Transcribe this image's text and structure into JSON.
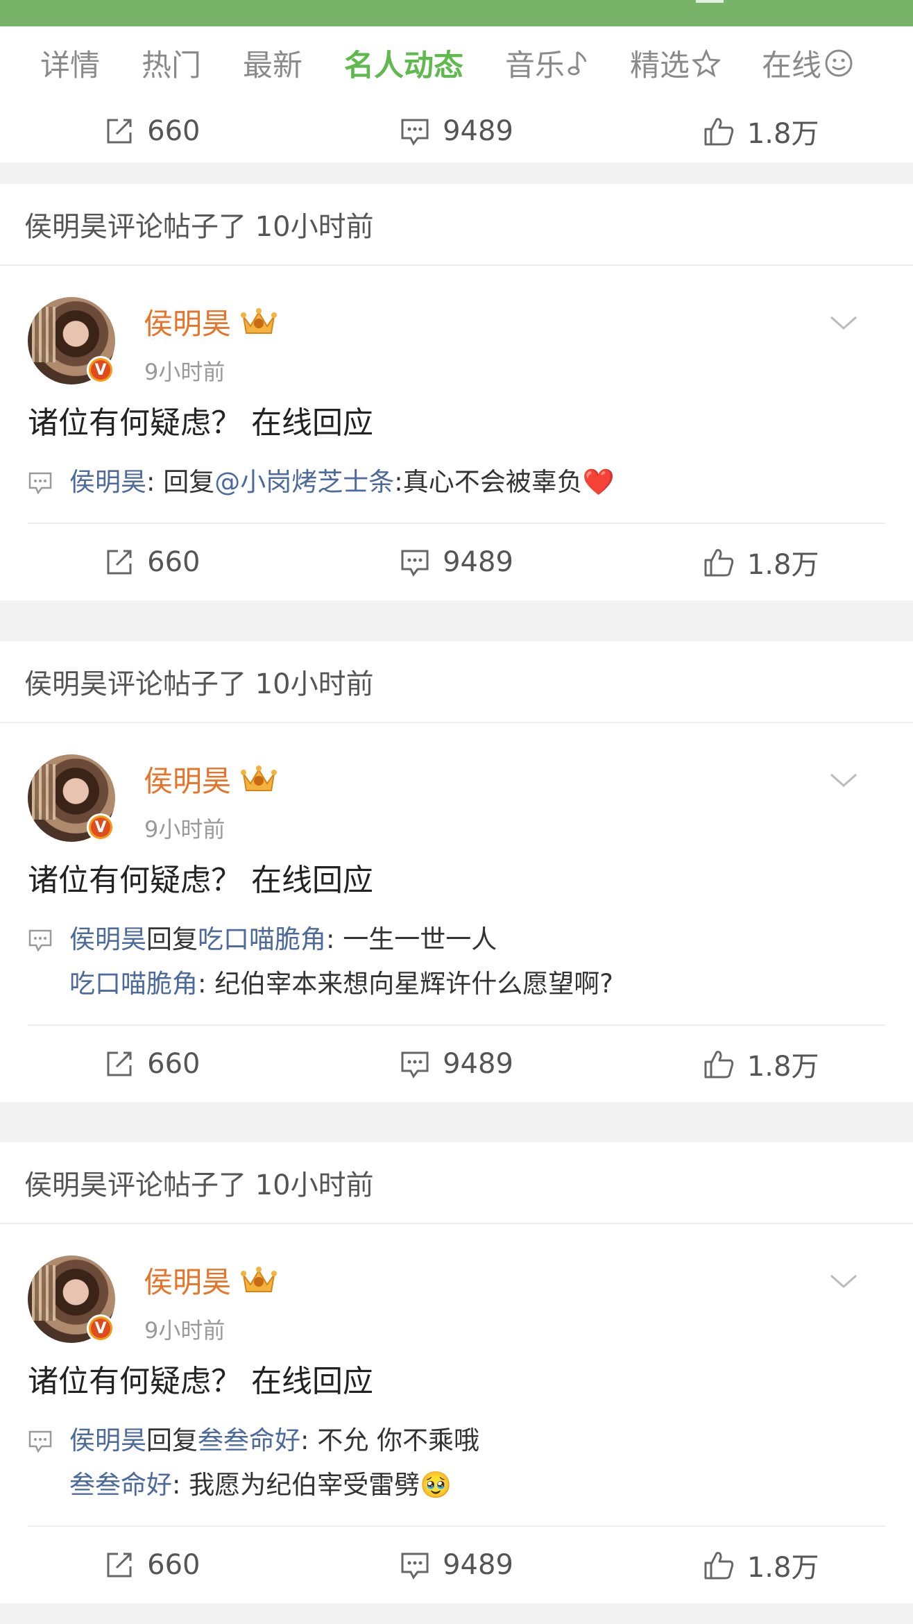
{
  "tabs": [
    {
      "label": "详情",
      "active": false
    },
    {
      "label": "热门",
      "active": false
    },
    {
      "label": "最新",
      "active": false
    },
    {
      "label": "名人动态",
      "active": true
    },
    {
      "label": "音乐",
      "active": false,
      "icon": "music-note-icon"
    },
    {
      "label": "精选",
      "active": false,
      "icon": "star-icon"
    },
    {
      "label": "在线",
      "active": false,
      "icon": "smiley-icon"
    }
  ],
  "stats": {
    "repost": "660",
    "comments": "9489",
    "likes": "1.8万"
  },
  "accent_color": "#5fba4e",
  "username_color": "#e8742a",
  "link_color": "#4c6a9c",
  "sections": [
    {
      "header": "侯明昊评论帖子了 10小时前",
      "user": {
        "name": "侯明昊",
        "time": "9小时前"
      },
      "content": "诸位有何疑虑？  在线回应",
      "reply_line1": {
        "author": "侯明昊",
        "middle": ": 回复",
        "target": "@小岗烤芝士条",
        "text": ":真心不会被辜负",
        "emoji": "❤️"
      }
    },
    {
      "header": "侯明昊评论帖子了 10小时前",
      "user": {
        "name": "侯明昊",
        "time": "9小时前"
      },
      "content": "诸位有何疑虑？  在线回应",
      "reply_line1": {
        "author": "侯明昊",
        "middle": "回复",
        "target": "吃口喵脆角",
        "text": ": 一生一世一人"
      },
      "reply_line2": {
        "author": "吃口喵脆角",
        "text": ": 纪伯宰本来想向星辉许什么愿望啊?"
      }
    },
    {
      "header": "侯明昊评论帖子了 10小时前",
      "user": {
        "name": "侯明昊",
        "time": "9小时前"
      },
      "content": "诸位有何疑虑？  在线回应",
      "reply_line1": {
        "author": "侯明昊",
        "middle": "回复",
        "target": "叁叁命好",
        "text": ": 不允 你不乘哦"
      },
      "reply_line2": {
        "author": "叁叁命好",
        "text": ": 我愿为纪伯宰受雷劈",
        "emoji": "🥹"
      }
    }
  ]
}
